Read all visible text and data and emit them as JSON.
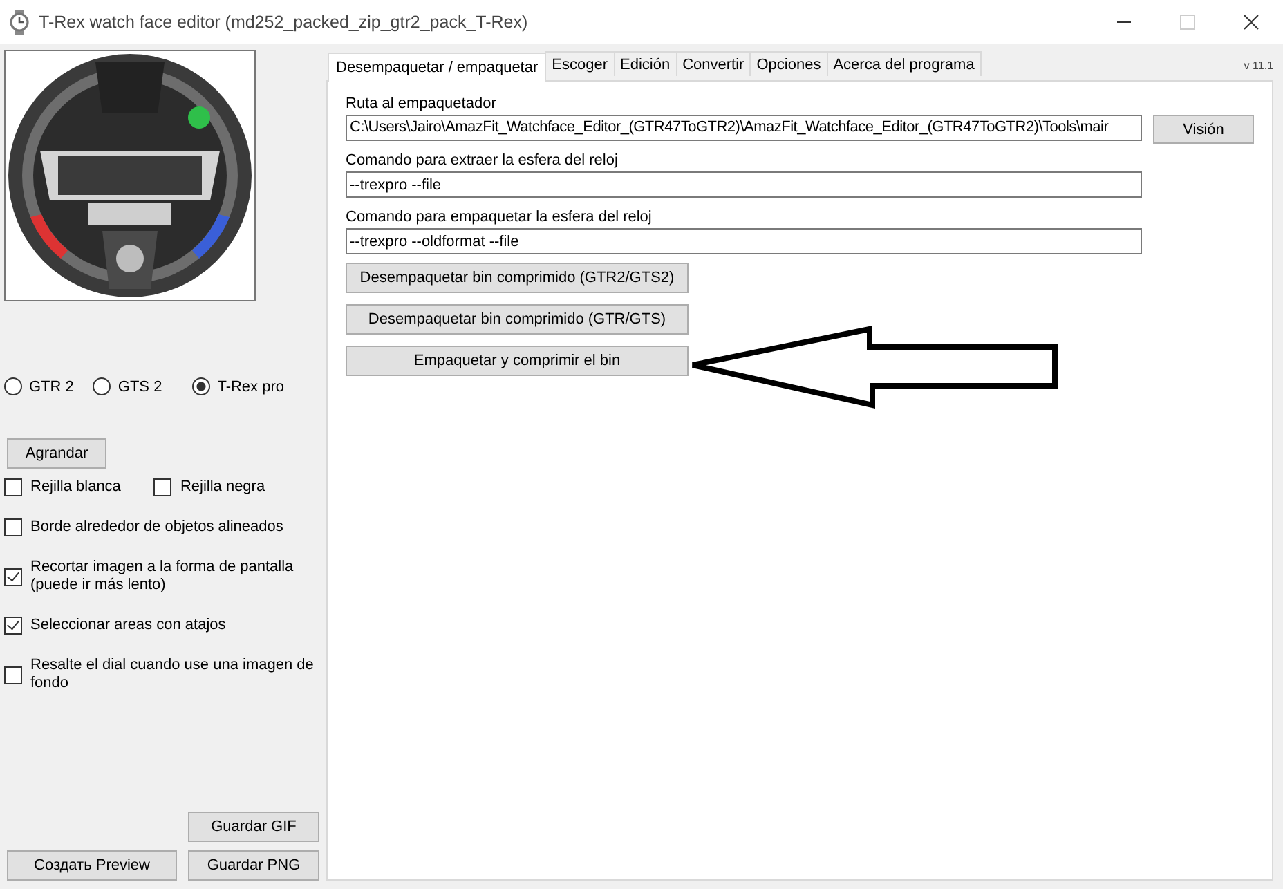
{
  "window": {
    "title": "T-Rex watch face editor (md252_packed_zip_gtr2_pack_T-Rex)"
  },
  "models": [
    {
      "label": "GTR 2",
      "selected": false
    },
    {
      "label": "GTS 2",
      "selected": false
    },
    {
      "label": "T-Rex pro",
      "selected": true
    }
  ],
  "zoom_button": "Agrandar",
  "option_rows": [
    [
      {
        "label": "Rejilla blanca",
        "checked": false
      },
      {
        "label": "Rejilla negra",
        "checked": false
      }
    ],
    [
      {
        "label": "Borde alrededor de objetos alineados",
        "checked": false
      }
    ],
    [
      {
        "label": "Recortar imagen a la forma de pantalla (puede ir más lento)",
        "checked": true
      }
    ],
    [
      {
        "label": "Seleccionar areas con atajos",
        "checked": true
      }
    ],
    [
      {
        "label": "Resalte el dial cuando use una imagen de fondo",
        "checked": false
      }
    ]
  ],
  "save_gif_button": "Guardar GIF",
  "create_preview_button": "Создать Preview",
  "save_png_button": "Guardar PNG",
  "tabs": [
    {
      "label": "Desempaquetar / empaquetar",
      "selected": true
    },
    {
      "label": "Escoger",
      "selected": false
    },
    {
      "label": "Edición",
      "selected": false
    },
    {
      "label": "Convertir",
      "selected": false
    },
    {
      "label": "Opciones",
      "selected": false
    },
    {
      "label": "Acerca del programa",
      "selected": false
    }
  ],
  "version": "v 11.1",
  "packer_path": {
    "label": "Ruta al empaquetador",
    "value": "C:\\Users\\Jairo\\AmazFit_Watchface_Editor_(GTR47ToGTR2)\\AmazFit_Watchface_Editor_(GTR47ToGTR2)\\Tools\\mair"
  },
  "browse_button": "Visión",
  "extract_command": {
    "label": "Comando para extraer la esfera del reloj",
    "value": "--trexpro --file"
  },
  "pack_command": {
    "label": "Comando para empaquetar la esfera del reloj",
    "value": "--trexpro --oldformat --file"
  },
  "actions": [
    "Desempaquetar bin comprimido (GTR2/GTS2)",
    "Desempaquetar bin comprimido (GTR/GTS)",
    "Empaquetar y comprimir el bin"
  ]
}
